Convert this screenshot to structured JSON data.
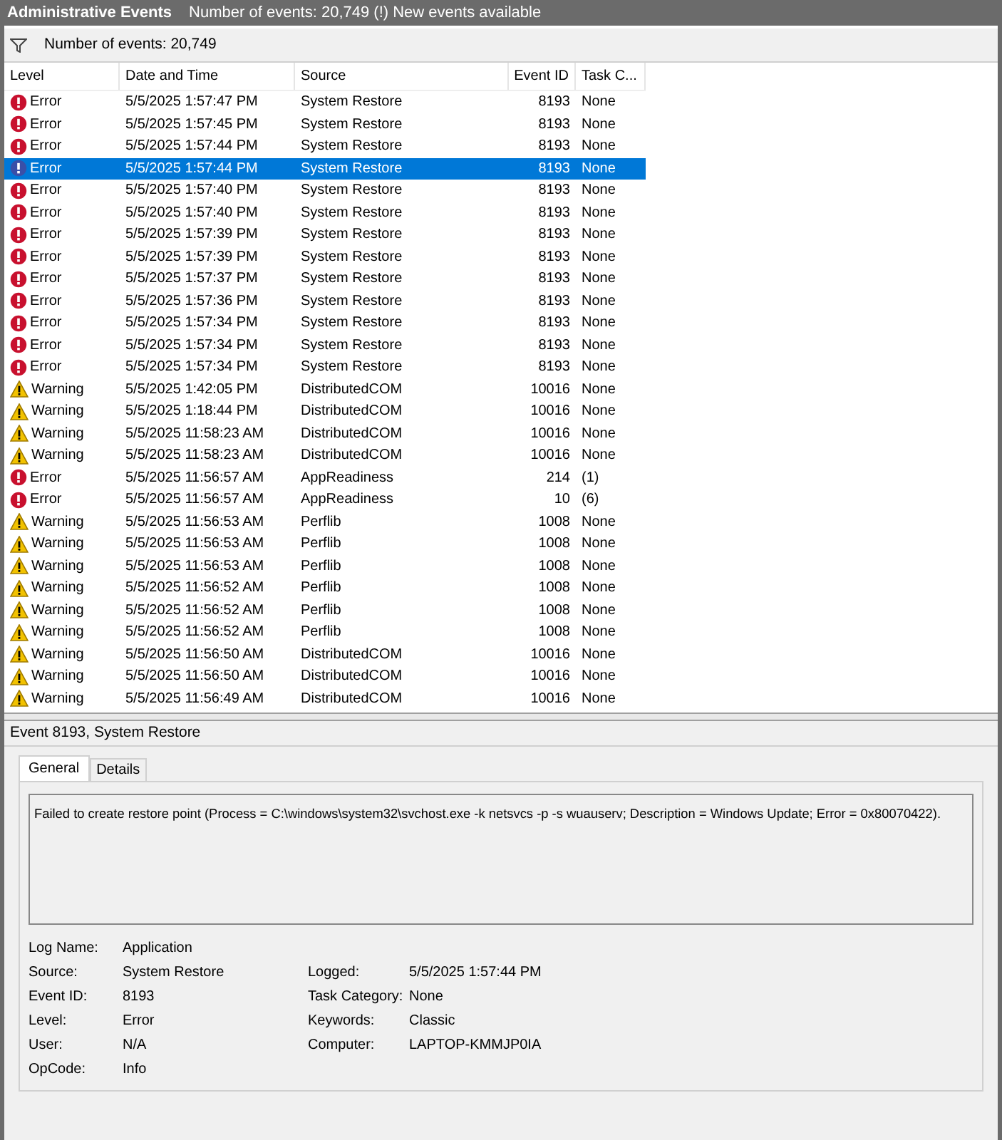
{
  "title_bar": {
    "title": "Administrative Events",
    "info": "Number of events: 20,749 (!) New events available"
  },
  "filter_bar": {
    "text": "Number of events: 20,749"
  },
  "table": {
    "columns": [
      "Level",
      "Date and Time",
      "Source",
      "Event ID",
      "Task C..."
    ],
    "rows": [
      {
        "kind": "error",
        "label": "Error",
        "date": "5/5/2025 1:57:47 PM",
        "source": "System Restore",
        "event_id": "8193",
        "task": "None",
        "selected": false
      },
      {
        "kind": "error",
        "label": "Error",
        "date": "5/5/2025 1:57:45 PM",
        "source": "System Restore",
        "event_id": "8193",
        "task": "None",
        "selected": false
      },
      {
        "kind": "error",
        "label": "Error",
        "date": "5/5/2025 1:57:44 PM",
        "source": "System Restore",
        "event_id": "8193",
        "task": "None",
        "selected": false
      },
      {
        "kind": "error",
        "label": "Error",
        "date": "5/5/2025 1:57:44 PM",
        "source": "System Restore",
        "event_id": "8193",
        "task": "None",
        "selected": true
      },
      {
        "kind": "error",
        "label": "Error",
        "date": "5/5/2025 1:57:40 PM",
        "source": "System Restore",
        "event_id": "8193",
        "task": "None",
        "selected": false
      },
      {
        "kind": "error",
        "label": "Error",
        "date": "5/5/2025 1:57:40 PM",
        "source": "System Restore",
        "event_id": "8193",
        "task": "None",
        "selected": false
      },
      {
        "kind": "error",
        "label": "Error",
        "date": "5/5/2025 1:57:39 PM",
        "source": "System Restore",
        "event_id": "8193",
        "task": "None",
        "selected": false
      },
      {
        "kind": "error",
        "label": "Error",
        "date": "5/5/2025 1:57:39 PM",
        "source": "System Restore",
        "event_id": "8193",
        "task": "None",
        "selected": false
      },
      {
        "kind": "error",
        "label": "Error",
        "date": "5/5/2025 1:57:37 PM",
        "source": "System Restore",
        "event_id": "8193",
        "task": "None",
        "selected": false
      },
      {
        "kind": "error",
        "label": "Error",
        "date": "5/5/2025 1:57:36 PM",
        "source": "System Restore",
        "event_id": "8193",
        "task": "None",
        "selected": false
      },
      {
        "kind": "error",
        "label": "Error",
        "date": "5/5/2025 1:57:34 PM",
        "source": "System Restore",
        "event_id": "8193",
        "task": "None",
        "selected": false
      },
      {
        "kind": "error",
        "label": "Error",
        "date": "5/5/2025 1:57:34 PM",
        "source": "System Restore",
        "event_id": "8193",
        "task": "None",
        "selected": false
      },
      {
        "kind": "error",
        "label": "Error",
        "date": "5/5/2025 1:57:34 PM",
        "source": "System Restore",
        "event_id": "8193",
        "task": "None",
        "selected": false
      },
      {
        "kind": "warning",
        "label": "Warning",
        "date": "5/5/2025 1:42:05 PM",
        "source": "DistributedCOM",
        "event_id": "10016",
        "task": "None",
        "selected": false
      },
      {
        "kind": "warning",
        "label": "Warning",
        "date": "5/5/2025 1:18:44 PM",
        "source": "DistributedCOM",
        "event_id": "10016",
        "task": "None",
        "selected": false
      },
      {
        "kind": "warning",
        "label": "Warning",
        "date": "5/5/2025 11:58:23 AM",
        "source": "DistributedCOM",
        "event_id": "10016",
        "task": "None",
        "selected": false
      },
      {
        "kind": "warning",
        "label": "Warning",
        "date": "5/5/2025 11:58:23 AM",
        "source": "DistributedCOM",
        "event_id": "10016",
        "task": "None",
        "selected": false
      },
      {
        "kind": "error",
        "label": "Error",
        "date": "5/5/2025 11:56:57 AM",
        "source": "AppReadiness",
        "event_id": "214",
        "task": "(1)",
        "selected": false
      },
      {
        "kind": "error",
        "label": "Error",
        "date": "5/5/2025 11:56:57 AM",
        "source": "AppReadiness",
        "event_id": "10",
        "task": "(6)",
        "selected": false
      },
      {
        "kind": "warning",
        "label": "Warning",
        "date": "5/5/2025 11:56:53 AM",
        "source": "Perflib",
        "event_id": "1008",
        "task": "None",
        "selected": false
      },
      {
        "kind": "warning",
        "label": "Warning",
        "date": "5/5/2025 11:56:53 AM",
        "source": "Perflib",
        "event_id": "1008",
        "task": "None",
        "selected": false
      },
      {
        "kind": "warning",
        "label": "Warning",
        "date": "5/5/2025 11:56:53 AM",
        "source": "Perflib",
        "event_id": "1008",
        "task": "None",
        "selected": false
      },
      {
        "kind": "warning",
        "label": "Warning",
        "date": "5/5/2025 11:56:52 AM",
        "source": "Perflib",
        "event_id": "1008",
        "task": "None",
        "selected": false
      },
      {
        "kind": "warning",
        "label": "Warning",
        "date": "5/5/2025 11:56:52 AM",
        "source": "Perflib",
        "event_id": "1008",
        "task": "None",
        "selected": false
      },
      {
        "kind": "warning",
        "label": "Warning",
        "date": "5/5/2025 11:56:52 AM",
        "source": "Perflib",
        "event_id": "1008",
        "task": "None",
        "selected": false
      },
      {
        "kind": "warning",
        "label": "Warning",
        "date": "5/5/2025 11:56:50 AM",
        "source": "DistributedCOM",
        "event_id": "10016",
        "task": "None",
        "selected": false
      },
      {
        "kind": "warning",
        "label": "Warning",
        "date": "5/5/2025 11:56:50 AM",
        "source": "DistributedCOM",
        "event_id": "10016",
        "task": "None",
        "selected": false
      },
      {
        "kind": "warning",
        "label": "Warning",
        "date": "5/5/2025 11:56:49 AM",
        "source": "DistributedCOM",
        "event_id": "10016",
        "task": "None",
        "selected": false
      }
    ]
  },
  "detail": {
    "header": "Event 8193, System Restore",
    "tabs": [
      {
        "label": "General",
        "selected": true
      },
      {
        "label": "Details",
        "selected": false
      }
    ],
    "message": "Failed to create restore point (Process = C:\\windows\\system32\\svchost.exe -k netsvcs -p -s wuauserv; Description = Windows Update; Error = 0x80070422).",
    "fields_left": [
      {
        "label": "Log Name:",
        "value": "Application"
      },
      {
        "label": "Source:",
        "value": "System Restore"
      },
      {
        "label": "Event ID:",
        "value": "8193"
      },
      {
        "label": "Level:",
        "value": "Error"
      },
      {
        "label": "User:",
        "value": "N/A"
      },
      {
        "label": "OpCode:",
        "value": "Info"
      }
    ],
    "fields_right": [
      {
        "label": "Logged:",
        "value": "5/5/2025 1:57:44 PM"
      },
      {
        "label": "Task Category:",
        "value": "None"
      },
      {
        "label": "Keywords:",
        "value": "Classic"
      },
      {
        "label": "Computer:",
        "value": "LAPTOP-KMMJP0IA"
      }
    ]
  }
}
